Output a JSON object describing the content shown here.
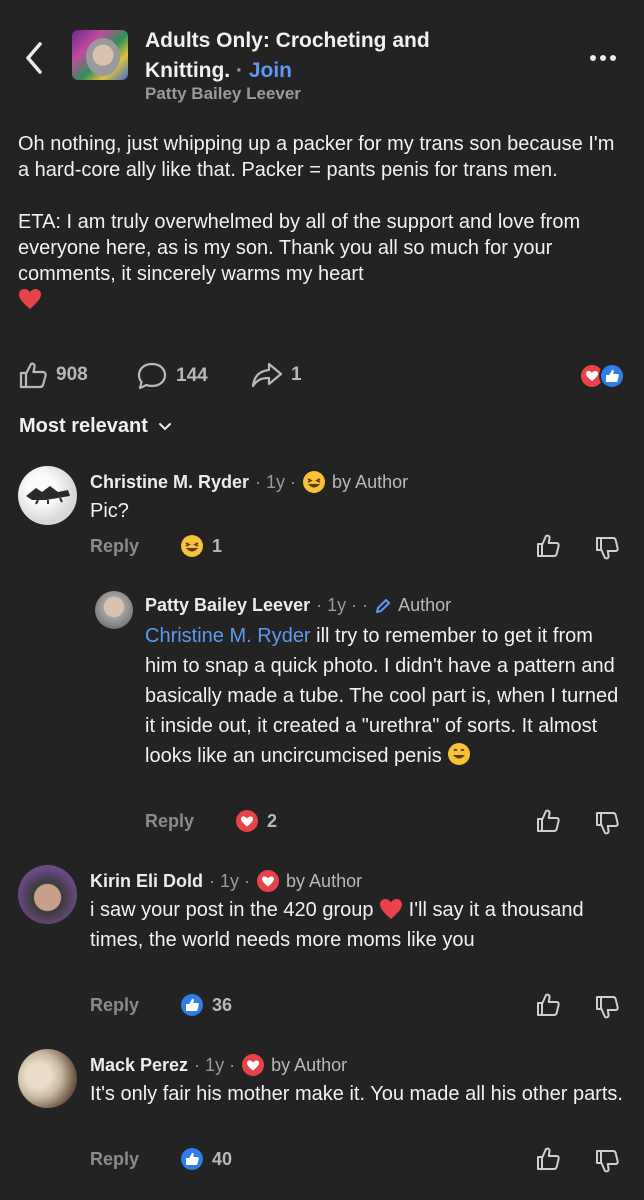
{
  "header": {
    "title_line1": "Adults Only: Crocheting and",
    "title_line2": "Knitting.",
    "separator": " · ",
    "join_label": "Join",
    "author": "Patty Bailey Leever"
  },
  "post": {
    "paragraph1": "Oh nothing, just whipping up a packer for my trans son because I'm a hard-core ally like that. Packer = pants penis for trans men.",
    "paragraph2": "ETA: I am truly overwhelmed by all of the support and love from everyone here, as is my son. Thank you all so much for your comments, it sincerely warms my heart",
    "likes": "908",
    "comments": "144",
    "shares": "1"
  },
  "sort": {
    "label": "Most relevant"
  },
  "comments": [
    {
      "name": "Christine M. Ryder",
      "meta": "· 1y ·",
      "badge": "by Author",
      "text": "Pic?",
      "reply_label": "Reply",
      "reaction_count": "1"
    },
    {
      "name": "Patty Bailey Leever",
      "meta": "· 1y · ·",
      "badge": "Author",
      "mention": "Christine M. Ryder",
      "text": " ill try to remember to get it from him to snap a quick photo. I didn't have a pattern and basically made a tube. The cool part is, when I turned it inside out, it created a \"urethra\" of sorts. It almost looks like an uncircumcised penis",
      "reply_label": "Reply",
      "reaction_count": "2"
    },
    {
      "name": "Kirin Eli Dold",
      "meta": "· 1y ·",
      "badge": "by Author",
      "text_before": "i saw your post in the 420 group",
      "text_after": " I'll say it a thousand times, the world needs more moms like you",
      "reply_label": "Reply",
      "reaction_count": "36"
    },
    {
      "name": "Mack Perez",
      "meta": "· 1y ·",
      "badge": "by Author",
      "text": "It's only fair his mother make it. You made all his other parts.",
      "reply_label": "Reply",
      "reaction_count": "40"
    }
  ],
  "colors": {
    "background": "#232323",
    "link_blue": "#5b9af0",
    "heart_red": "#e8424a",
    "like_blue": "#2e7de8"
  }
}
